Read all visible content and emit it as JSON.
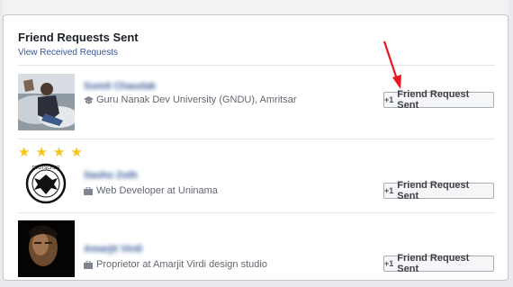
{
  "header": {
    "title": "Friend Requests Sent",
    "link": "View Received Requests"
  },
  "requests": [
    {
      "name": "Sumit Chaudak",
      "info_icon": "graduation-cap-icon",
      "info": "Guru Nanak Dev University (GNDU), Amritsar",
      "button_label": "Friend Request Sent"
    },
    {
      "name": "Sasho Zoth",
      "info_icon": "briefcase-icon",
      "info": "Web Developer at Uninama",
      "button_label": "Friend Request Sent",
      "stars": 4
    },
    {
      "name": "Amarjit Virdi",
      "info_icon": "briefcase-icon",
      "info": "Proprietor at Amarjit Virdi design studio",
      "button_label": "Friend Request Sent"
    }
  ],
  "colors": {
    "link": "#365899",
    "annotation_arrow": "#e8181c",
    "star": "#f5c518"
  }
}
